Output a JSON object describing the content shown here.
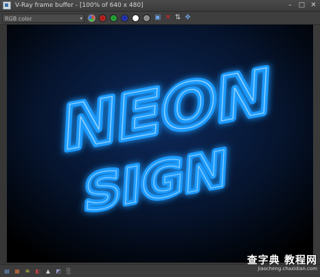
{
  "window": {
    "title": "V-Ray frame buffer - [100% of 640 x 480]",
    "minimize_glyph": "–",
    "maximize_glyph": "□",
    "close_glyph": "✕"
  },
  "toolbar": {
    "channel_select_value": "RGB color",
    "icons": [
      "rgb-channels-icon",
      "red-channel-icon",
      "green-channel-icon",
      "blue-channel-icon",
      "alpha-channel-icon",
      "monochrome-icon",
      "save-icon",
      "clear-icon",
      "track-mouse-icon",
      "region-render-icon"
    ]
  },
  "canvas": {
    "line1": "NEON",
    "line2": "SIGN",
    "neon_color": "#1e9bff",
    "glow_color": "#0a4fb0"
  },
  "statusbar": {
    "icons": [
      "color-corrections-icon",
      "levels-icon",
      "curve-icon",
      "exposure-icon",
      "histogram-icon",
      "lut-icon",
      "pixel-aspect-icon"
    ]
  },
  "watermark": {
    "main": "查字典 教程网",
    "sub": "jiaocheng.chazidian.com"
  }
}
